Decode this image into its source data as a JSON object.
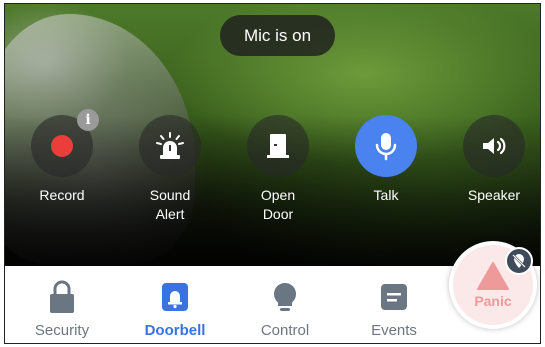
{
  "status_pill": {
    "text": "Mic is on"
  },
  "controls": [
    {
      "label": "Record",
      "icon": "record-icon"
    },
    {
      "label": "Sound\nAlert",
      "icon": "siren-icon"
    },
    {
      "label": "Open\nDoor",
      "icon": "door-icon"
    },
    {
      "label": "Talk",
      "icon": "microphone-icon",
      "active": true
    },
    {
      "label": "Speaker",
      "icon": "speaker-icon"
    }
  ],
  "info_badge": {
    "symbol": "i"
  },
  "nav": {
    "items": [
      {
        "label": "Security",
        "icon": "lock-icon"
      },
      {
        "label": "Doorbell",
        "icon": "doorbell-icon",
        "active": true
      },
      {
        "label": "Control",
        "icon": "bulb-icon"
      },
      {
        "label": "Events",
        "icon": "events-icon"
      }
    ]
  },
  "panic": {
    "label": "Panic",
    "icon": "warning-icon",
    "badge_icon": "location-off-icon"
  },
  "colors": {
    "accent": "#4a82f0",
    "record": "#ea3e3a",
    "panic_text": "#ef9a9a",
    "nav_inactive": "#6b7683"
  }
}
